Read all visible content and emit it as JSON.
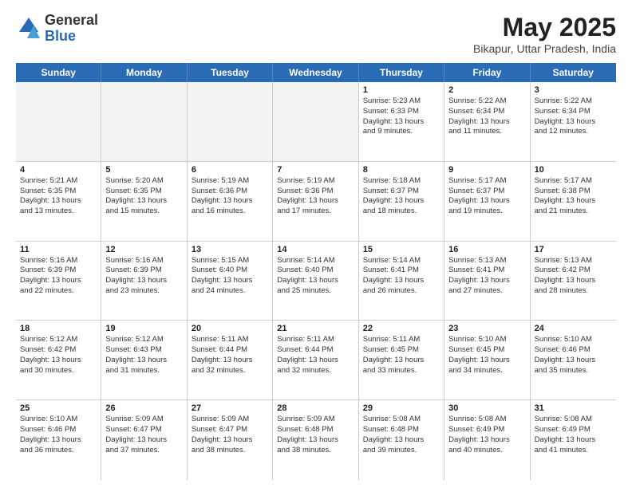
{
  "logo": {
    "general": "General",
    "blue": "Blue"
  },
  "title": {
    "month_year": "May 2025",
    "location": "Bikapur, Uttar Pradesh, India"
  },
  "header_days": [
    "Sunday",
    "Monday",
    "Tuesday",
    "Wednesday",
    "Thursday",
    "Friday",
    "Saturday"
  ],
  "weeks": [
    [
      {
        "day": "",
        "info": "",
        "shaded": true
      },
      {
        "day": "",
        "info": "",
        "shaded": true
      },
      {
        "day": "",
        "info": "",
        "shaded": true
      },
      {
        "day": "",
        "info": "",
        "shaded": true
      },
      {
        "day": "1",
        "info": "Sunrise: 5:23 AM\nSunset: 6:33 PM\nDaylight: 13 hours\nand 9 minutes."
      },
      {
        "day": "2",
        "info": "Sunrise: 5:22 AM\nSunset: 6:34 PM\nDaylight: 13 hours\nand 11 minutes."
      },
      {
        "day": "3",
        "info": "Sunrise: 5:22 AM\nSunset: 6:34 PM\nDaylight: 13 hours\nand 12 minutes."
      }
    ],
    [
      {
        "day": "4",
        "info": "Sunrise: 5:21 AM\nSunset: 6:35 PM\nDaylight: 13 hours\nand 13 minutes."
      },
      {
        "day": "5",
        "info": "Sunrise: 5:20 AM\nSunset: 6:35 PM\nDaylight: 13 hours\nand 15 minutes."
      },
      {
        "day": "6",
        "info": "Sunrise: 5:19 AM\nSunset: 6:36 PM\nDaylight: 13 hours\nand 16 minutes."
      },
      {
        "day": "7",
        "info": "Sunrise: 5:19 AM\nSunset: 6:36 PM\nDaylight: 13 hours\nand 17 minutes."
      },
      {
        "day": "8",
        "info": "Sunrise: 5:18 AM\nSunset: 6:37 PM\nDaylight: 13 hours\nand 18 minutes."
      },
      {
        "day": "9",
        "info": "Sunrise: 5:17 AM\nSunset: 6:37 PM\nDaylight: 13 hours\nand 19 minutes."
      },
      {
        "day": "10",
        "info": "Sunrise: 5:17 AM\nSunset: 6:38 PM\nDaylight: 13 hours\nand 21 minutes."
      }
    ],
    [
      {
        "day": "11",
        "info": "Sunrise: 5:16 AM\nSunset: 6:39 PM\nDaylight: 13 hours\nand 22 minutes."
      },
      {
        "day": "12",
        "info": "Sunrise: 5:16 AM\nSunset: 6:39 PM\nDaylight: 13 hours\nand 23 minutes."
      },
      {
        "day": "13",
        "info": "Sunrise: 5:15 AM\nSunset: 6:40 PM\nDaylight: 13 hours\nand 24 minutes."
      },
      {
        "day": "14",
        "info": "Sunrise: 5:14 AM\nSunset: 6:40 PM\nDaylight: 13 hours\nand 25 minutes."
      },
      {
        "day": "15",
        "info": "Sunrise: 5:14 AM\nSunset: 6:41 PM\nDaylight: 13 hours\nand 26 minutes."
      },
      {
        "day": "16",
        "info": "Sunrise: 5:13 AM\nSunset: 6:41 PM\nDaylight: 13 hours\nand 27 minutes."
      },
      {
        "day": "17",
        "info": "Sunrise: 5:13 AM\nSunset: 6:42 PM\nDaylight: 13 hours\nand 28 minutes."
      }
    ],
    [
      {
        "day": "18",
        "info": "Sunrise: 5:12 AM\nSunset: 6:42 PM\nDaylight: 13 hours\nand 30 minutes."
      },
      {
        "day": "19",
        "info": "Sunrise: 5:12 AM\nSunset: 6:43 PM\nDaylight: 13 hours\nand 31 minutes."
      },
      {
        "day": "20",
        "info": "Sunrise: 5:11 AM\nSunset: 6:44 PM\nDaylight: 13 hours\nand 32 minutes."
      },
      {
        "day": "21",
        "info": "Sunrise: 5:11 AM\nSunset: 6:44 PM\nDaylight: 13 hours\nand 32 minutes."
      },
      {
        "day": "22",
        "info": "Sunrise: 5:11 AM\nSunset: 6:45 PM\nDaylight: 13 hours\nand 33 minutes."
      },
      {
        "day": "23",
        "info": "Sunrise: 5:10 AM\nSunset: 6:45 PM\nDaylight: 13 hours\nand 34 minutes."
      },
      {
        "day": "24",
        "info": "Sunrise: 5:10 AM\nSunset: 6:46 PM\nDaylight: 13 hours\nand 35 minutes."
      }
    ],
    [
      {
        "day": "25",
        "info": "Sunrise: 5:10 AM\nSunset: 6:46 PM\nDaylight: 13 hours\nand 36 minutes."
      },
      {
        "day": "26",
        "info": "Sunrise: 5:09 AM\nSunset: 6:47 PM\nDaylight: 13 hours\nand 37 minutes."
      },
      {
        "day": "27",
        "info": "Sunrise: 5:09 AM\nSunset: 6:47 PM\nDaylight: 13 hours\nand 38 minutes."
      },
      {
        "day": "28",
        "info": "Sunrise: 5:09 AM\nSunset: 6:48 PM\nDaylight: 13 hours\nand 38 minutes."
      },
      {
        "day": "29",
        "info": "Sunrise: 5:08 AM\nSunset: 6:48 PM\nDaylight: 13 hours\nand 39 minutes."
      },
      {
        "day": "30",
        "info": "Sunrise: 5:08 AM\nSunset: 6:49 PM\nDaylight: 13 hours\nand 40 minutes."
      },
      {
        "day": "31",
        "info": "Sunrise: 5:08 AM\nSunset: 6:49 PM\nDaylight: 13 hours\nand 41 minutes."
      }
    ]
  ]
}
